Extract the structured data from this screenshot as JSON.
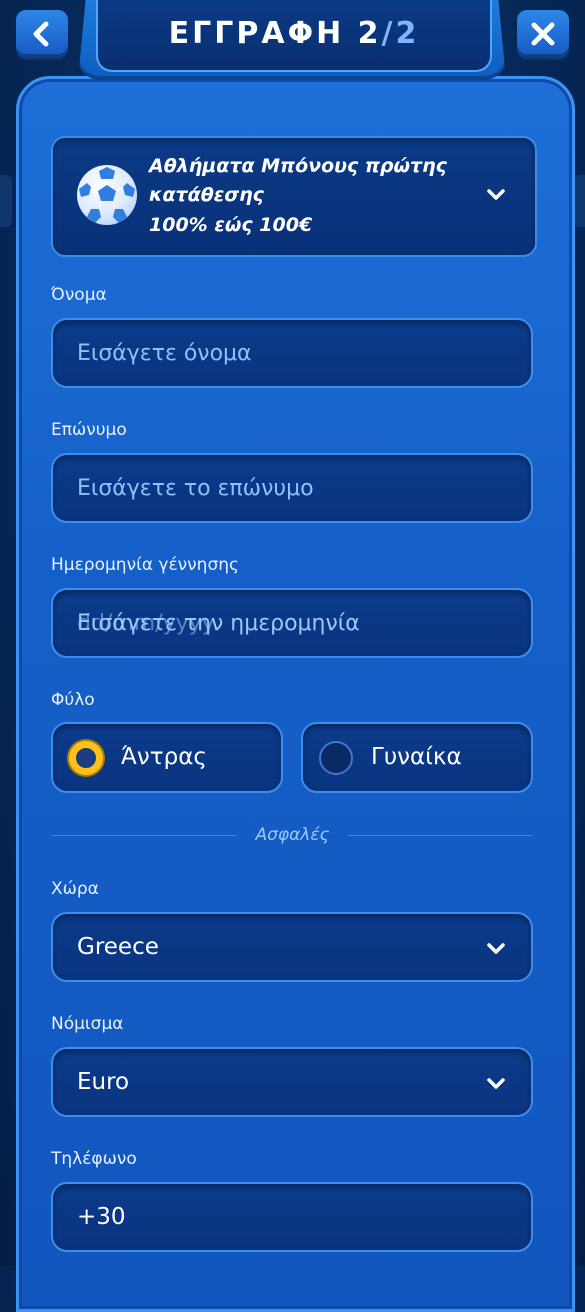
{
  "header": {
    "title": "ΕΓΓΡΑΦΗ",
    "step": "2",
    "separator": "/",
    "total": "2",
    "back_icon": "chevron-left-icon",
    "close_icon": "close-icon"
  },
  "bonus": {
    "title": "Αθλήματα Μπόνους πρώτης κατάθεσης",
    "subtitle": "100% εώς 100€",
    "icon": "soccer-ball-icon"
  },
  "form": {
    "first_name": {
      "label": "Όνομα",
      "placeholder": "Εισάγετε όνομα"
    },
    "last_name": {
      "label": "Επώνυμο",
      "placeholder": "Εισάγετε το επώνυμο"
    },
    "birth_date": {
      "label": "Ημερομηνία γέννησης",
      "placeholder": "Εισάγετε την ημερομηνία",
      "placeholder_overlay": "dd/mm/yyyy"
    },
    "gender": {
      "label": "Φύλο",
      "options": [
        "Άντρας",
        "Γυναίκα"
      ],
      "selected": "Άντρας"
    },
    "divider_text": "Ασφαλές",
    "country": {
      "label": "Χώρα",
      "value": "Greece"
    },
    "currency": {
      "label": "Νόμισμα",
      "value": "Euro"
    },
    "phone": {
      "label": "Τηλέφωνο",
      "value": "+30"
    }
  },
  "colors": {
    "accent": "#1e6fd8",
    "field_bg": "#0b3b8a",
    "placeholder": "#8fc0ff",
    "radio_selected": "#ffc21a"
  }
}
